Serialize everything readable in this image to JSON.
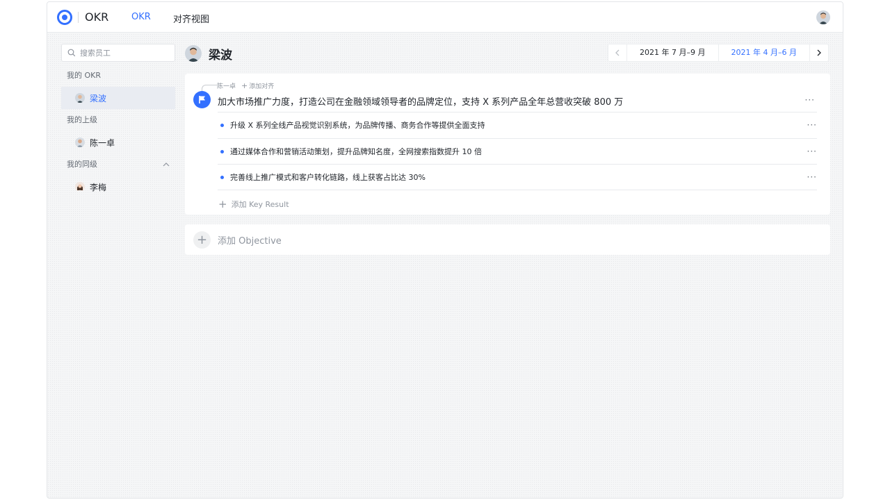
{
  "colors": {
    "accent": "#3370ff",
    "text": "#1f2329",
    "muted": "#8f959e",
    "canvas": "#f5f6f7"
  },
  "header": {
    "app_name": "OKR",
    "tabs": [
      {
        "label": "OKR",
        "active": true
      },
      {
        "label": "对齐视图",
        "active": false
      }
    ],
    "logo_icon": "target-ring-icon",
    "user_avatar_icon": "avatar-icon"
  },
  "sidebar": {
    "search": {
      "placeholder": "搜索员工",
      "value": ""
    },
    "groups": [
      {
        "title": "我的 OKR",
        "people": [
          {
            "name": "梁波",
            "active": true
          }
        ]
      },
      {
        "title": "我的上级",
        "people": [
          {
            "name": "陈一卓",
            "active": false
          }
        ]
      },
      {
        "title": "我的同级",
        "expanded": true,
        "people": [
          {
            "name": "李梅",
            "active": false
          }
        ]
      }
    ]
  },
  "main": {
    "title": "梁波",
    "periods": [
      {
        "label": "2021 年 7 月–9 月",
        "active": false
      },
      {
        "label": "2021 年 4 月–6 月",
        "active": true
      }
    ],
    "objective": {
      "aligned_to": "陈一卓",
      "add_alignment_label": "添加对齐",
      "title": "加大市场推广力度，打造公司在金融领域领导者的品牌定位，支持 X 系列产品全年总营收突破 800 万",
      "more_label": "···",
      "key_results": [
        {
          "text": "升级 X 系列全线产品视觉识别系统，为品牌传播、商务合作等提供全面支持"
        },
        {
          "text": "通过媒体合作和营销活动策划，提升品牌知名度，全网搜索指数提升 10 倍"
        },
        {
          "text": "完善线上推广模式和客户转化链路，线上获客占比达 30%"
        }
      ],
      "add_kr_label": "添加 Key Result"
    },
    "add_objective_label": "添加 Objective"
  }
}
